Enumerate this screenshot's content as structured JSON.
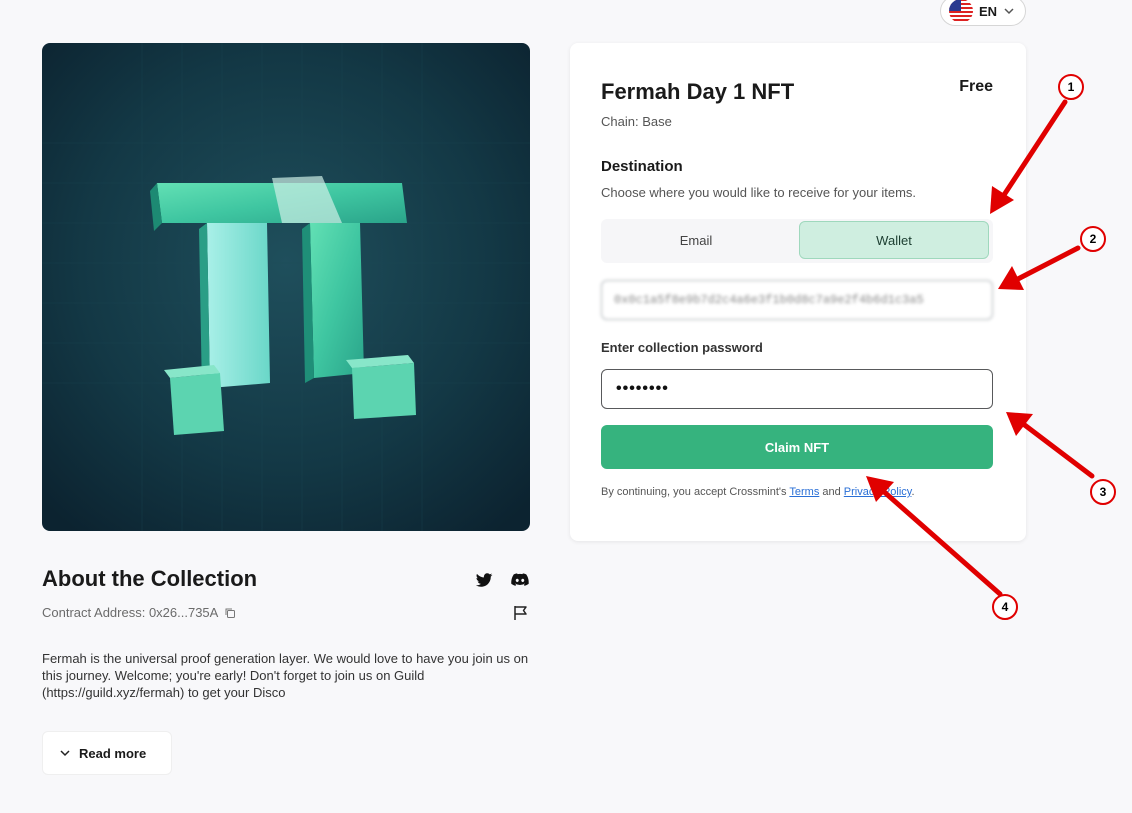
{
  "header": {
    "language": "EN",
    "flag_icon": "us-flag-icon"
  },
  "collection": {
    "about_title": "About the Collection",
    "contract_label": "Contract Address: 0x26...735A",
    "description": "Fermah is the universal proof generation layer. We would love to have you join us on this journey. Welcome; you're early! Don't forget to join us on Guild (https://guild.xyz/fermah) to get your Disco",
    "read_more": "Read more"
  },
  "card": {
    "title": "Fermah Day 1 NFT",
    "price": "Free",
    "chain": "Chain: Base",
    "destination_title": "Destination",
    "destination_sub": "Choose where you would like to receive for your items.",
    "tabs": [
      {
        "label": "Email"
      },
      {
        "label": "Wallet"
      }
    ],
    "wallet_value": "0x0c1a5f8e9b7d2c4a6e3f1b0d8c7a9e2f4b6d1c3a5",
    "password_label": "Enter collection password",
    "password_value": "••••••••",
    "claim_label": "Claim NFT",
    "terms_prefix": "By continuing, you accept Crossmint's ",
    "terms_link": "Terms",
    "terms_mid": " and ",
    "privacy_link": "Privacy Policy",
    "terms_suffix": "."
  },
  "annotations": [
    {
      "label": "1"
    },
    {
      "label": "2"
    },
    {
      "label": "3"
    },
    {
      "label": "4"
    }
  ],
  "colors": {
    "accent": "#36b37e",
    "wallet_tab": "#cfeee0",
    "annotation": "#e00000",
    "link": "#2a6fd6"
  }
}
